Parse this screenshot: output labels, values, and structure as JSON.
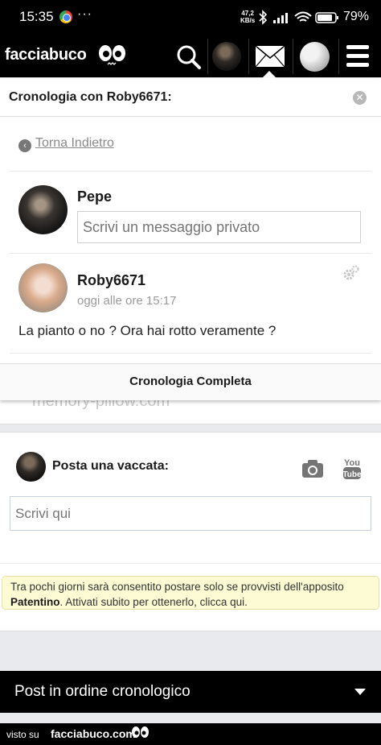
{
  "statusbar": {
    "time": "15:35",
    "dots": "···",
    "speed_value": "47,2",
    "speed_unit": "KB/s",
    "battery_pct": "79%"
  },
  "header": {
    "logo": "facciabuco",
    "icons": [
      "search-icon",
      "user-avatar",
      "messages-icon",
      "moon-icon",
      "menu-icon"
    ]
  },
  "popup": {
    "title": "Cronologia con Roby6671:",
    "back_label": "Torna Indietro",
    "reply": {
      "name": "Pepe",
      "placeholder": "Scrivi un messaggio privato"
    },
    "message": {
      "author": "Roby6671",
      "time": "oggi alle ore 15:17",
      "text": "La pianto o no ? Ora hai rotto veramente ?"
    },
    "full_history_label": "Cronologia Completa"
  },
  "behind": {
    "text": "memory-pillow.com"
  },
  "post": {
    "title": "Posta una vaccata:",
    "placeholder": "Scrivi qui",
    "notice_1": "Tra pochi giorni sarà consentito postare solo se provvisti dell'apposito",
    "notice_bold": "Patentino",
    "notice_2": ". Attivati subito per ottenerlo, clicca qui."
  },
  "chronological": {
    "label": "Post in ordine cronologico"
  },
  "footer": {
    "visto": "visto su",
    "logo": "facciabuco.com"
  },
  "colors": {
    "header_bg": "#000000",
    "notice_bg": "#fdfbd3",
    "link_gray": "#8a8a8a"
  }
}
